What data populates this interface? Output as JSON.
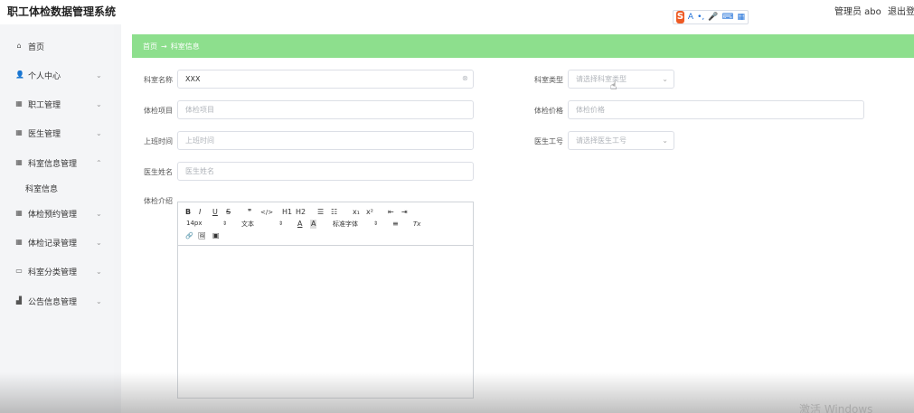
{
  "app": {
    "title": "职工体检数据管理系统",
    "user_label": "管理员 abo",
    "logout_label": "退出登录"
  },
  "ime_toolbar": {
    "logo": "S",
    "glyphs": [
      "A",
      "•,",
      "🎤",
      "⌨",
      "▦"
    ]
  },
  "sidebar": {
    "items": [
      {
        "label": "首页",
        "icon": "home-icon",
        "has_caret": false
      },
      {
        "label": "个人中心",
        "icon": "person-icon",
        "has_caret": true
      },
      {
        "label": "职工管理",
        "icon": "grid-icon",
        "has_caret": true
      },
      {
        "label": "医生管理",
        "icon": "grid-icon",
        "has_caret": true
      },
      {
        "label": "科室信息管理",
        "icon": "grid-icon",
        "has_caret": true
      },
      {
        "label": "体检预约管理",
        "icon": "grid-icon",
        "has_caret": true
      },
      {
        "label": "体检记录管理",
        "icon": "grid-icon",
        "has_caret": true
      },
      {
        "label": "科室分类管理",
        "icon": "chat-icon",
        "has_caret": true
      },
      {
        "label": "公告信息管理",
        "icon": "chart-icon",
        "has_caret": true
      }
    ],
    "submenu": {
      "label": "科室信息"
    }
  },
  "breadcrumb": {
    "home": "首页",
    "separator": "→",
    "current": "科室信息"
  },
  "form": {
    "dept_name": {
      "label": "科室名称",
      "value": "XXX"
    },
    "dept_type": {
      "label": "科室类型",
      "placeholder": "请选择科室类型"
    },
    "exam_item": {
      "label": "体检项目",
      "placeholder": "体检项目"
    },
    "exam_price": {
      "label": "体检价格",
      "placeholder": "体检价格"
    },
    "work_time": {
      "label": "上班时间",
      "placeholder": "上班时间"
    },
    "doctor_id": {
      "label": "医生工号",
      "placeholder": "请选择医生工号"
    },
    "doctor_name": {
      "label": "医生姓名",
      "placeholder": "医生姓名"
    },
    "exam_intro": {
      "label": "体检介绍"
    }
  },
  "editor": {
    "font_size": "14px",
    "block_type": "文本",
    "font_family": "标准字体",
    "buttons_row1": [
      "B",
      "I",
      "U",
      "S",
      "❞",
      "</>",
      "H1",
      "H2",
      "☰",
      "☷",
      "x₁",
      "x²",
      "⇤",
      "⇥"
    ],
    "buttons_row2_right": [
      "A",
      "A",
      "≡",
      "Tx"
    ],
    "buttons_row3": [
      "🔗",
      "🖼",
      "▣"
    ]
  },
  "watermark": "激活 Windows"
}
